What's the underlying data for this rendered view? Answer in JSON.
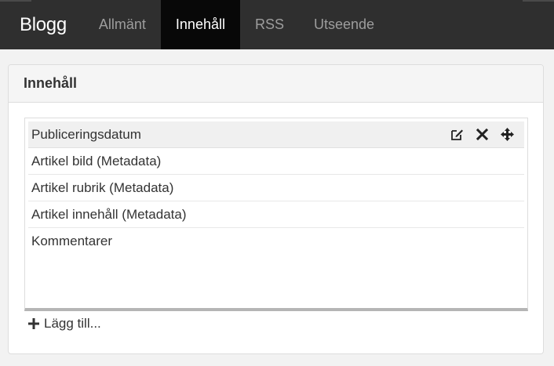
{
  "nav": {
    "brand": "Blogg",
    "tabs": [
      {
        "label": "Allmänt"
      },
      {
        "label": "Innehåll"
      },
      {
        "label": "RSS"
      },
      {
        "label": "Utseende"
      }
    ],
    "active_tab": "Innehåll"
  },
  "panel": {
    "title": "Innehåll",
    "items": [
      {
        "label": "Publiceringsdatum"
      },
      {
        "label": "Artikel bild (Metadata)"
      },
      {
        "label": "Artikel rubrik (Metadata)"
      },
      {
        "label": "Artikel innehåll (Metadata)"
      },
      {
        "label": "Kommentarer"
      }
    ],
    "item_action_icons": [
      "edit-icon",
      "remove-icon",
      "move-icon"
    ],
    "add_label": "Lägg till..."
  },
  "colors": {
    "navbar_bg": "#2f2f2f",
    "active_tab_bg": "#080808",
    "inactive_tab_text": "#9d9d9d"
  }
}
